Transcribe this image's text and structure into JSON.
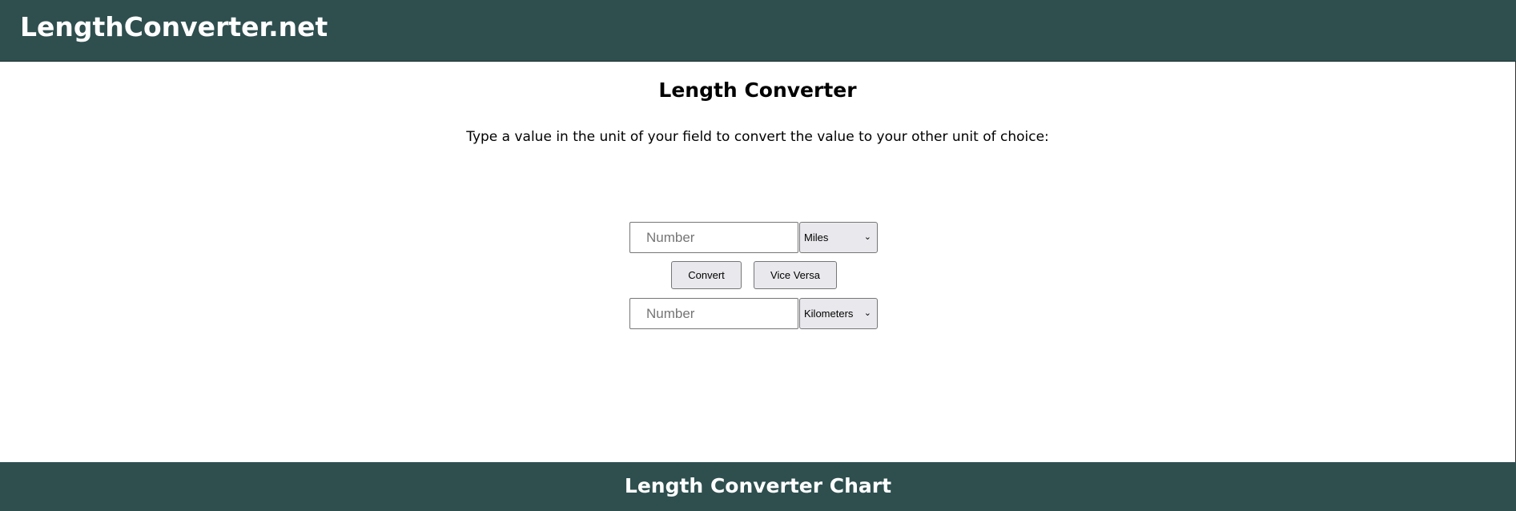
{
  "header": {
    "site_name": "LengthConverter.net"
  },
  "main": {
    "title": "Length Converter",
    "instructions": "Type a value in the unit of your field to convert the value to your other unit of choice:",
    "from": {
      "value": "",
      "placeholder": "Number",
      "unit": "Miles"
    },
    "to": {
      "value": "",
      "placeholder": "Number",
      "unit": "Kilometers"
    },
    "buttons": {
      "convert": "Convert",
      "vice_versa": "Vice Versa"
    }
  },
  "footer": {
    "title": "Length Converter Chart"
  },
  "colors": {
    "brand_bar": "#2f4f4f",
    "control_bg": "#e9e9ed"
  },
  "icons": {
    "select_arrow": "chevron-down-icon"
  }
}
